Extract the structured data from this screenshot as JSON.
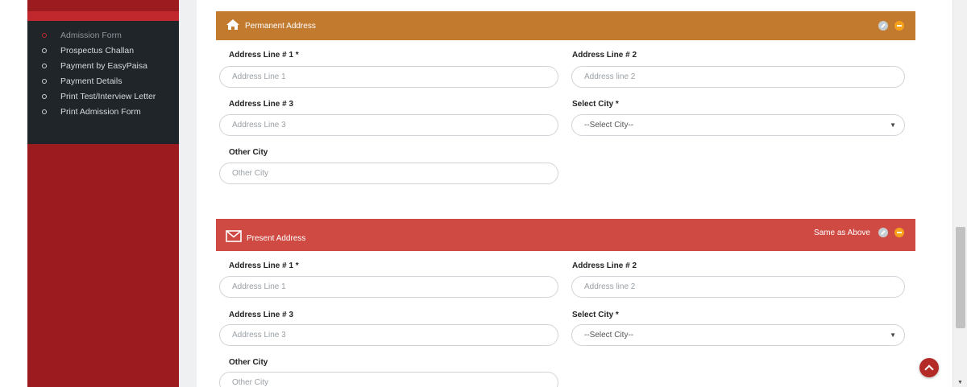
{
  "sidebar": {
    "items": [
      {
        "label": "Admission Form",
        "active": true
      },
      {
        "label": "Prospectus Challan",
        "active": false
      },
      {
        "label": "Payment by EasyPaisa",
        "active": false
      },
      {
        "label": "Payment Details",
        "active": false
      },
      {
        "label": "Print Test/Interview Letter",
        "active": false
      },
      {
        "label": "Print Admission Form",
        "active": false
      }
    ]
  },
  "permanent": {
    "title": "Permanent Address",
    "icon": "home-icon",
    "color": "#c27a2f",
    "addr1_label": "Address Line # 1 *",
    "addr1_placeholder": "Address Line 1",
    "addr2_label": "Address Line # 2",
    "addr2_placeholder": "Address line 2",
    "addr3_label": "Address Line # 3",
    "addr3_placeholder": "Address Line 3",
    "city_label": "Select City *",
    "city_value": "--Select City--",
    "other_label": "Other City",
    "other_placeholder": "Other City"
  },
  "present": {
    "title": "Present Address",
    "icon": "envelope-icon",
    "color": "#cf4a42",
    "same_label": "Same as Above",
    "addr1_label": "Address Line # 1 *",
    "addr1_placeholder": "Address Line 1",
    "addr2_label": "Address Line # 2",
    "addr2_placeholder": "Address line 2",
    "addr3_label": "Address Line # 3",
    "addr3_placeholder": "Address Line 3",
    "city_label": "Select City *",
    "city_value": "--Select City--",
    "other_label": "Other City",
    "other_placeholder": "Other City"
  }
}
